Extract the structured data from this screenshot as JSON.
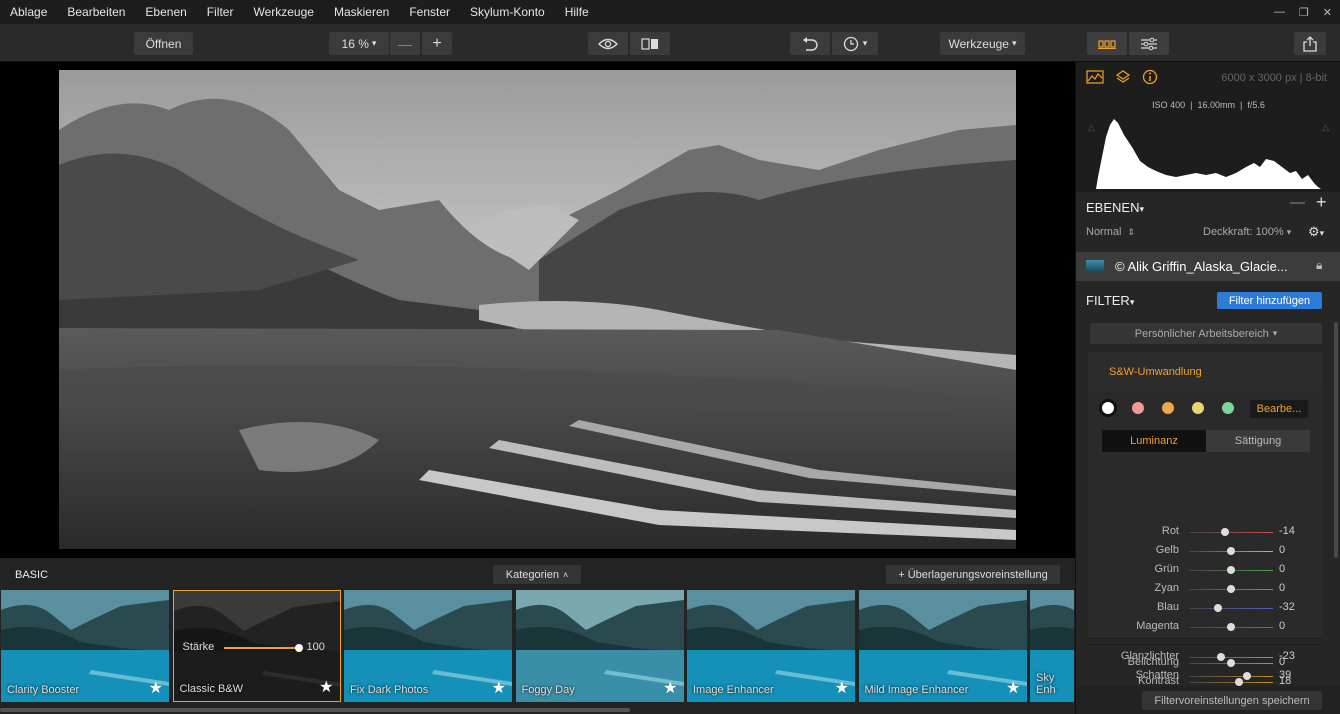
{
  "menu": [
    "Ablage",
    "Bearbeiten",
    "Ebenen",
    "Filter",
    "Werkzeuge",
    "Maskieren",
    "Fenster",
    "Skylum-Konto",
    "Hilfe"
  ],
  "toolbar": {
    "open_label": "Öffnen",
    "zoom_label": "16 %",
    "tools_label": "Werkzeuge"
  },
  "info": {
    "dimensions": "6000 x 3000 px",
    "bitdepth": "8-bit",
    "exif": "ISO 400  |  16.00mm  |  f/5.6"
  },
  "layers": {
    "title": "EBENEN",
    "blend_mode": "Normal",
    "opacity_label": "Deckkraft: 100%",
    "layer_name": "© Alik Griffin_Alaska_Glacie..."
  },
  "filter": {
    "title": "FILTER",
    "add_button": "Filter hinzufügen",
    "workspace": "Persönlicher Arbeitsbereich",
    "module_title": "S&W-Umwandlung",
    "edit_button": "Bearbe...",
    "tabs": [
      "Luminanz",
      "Sättigung"
    ],
    "save_button": "Filtervoreinstellungen speichern",
    "color_dots": [
      "#ffffff",
      "#f29a9a",
      "#f0a848",
      "#ead572",
      "#7fd49a"
    ],
    "luminance_sliders": [
      {
        "label": "Rot",
        "value": "-14",
        "color": "#c85050",
        "level": 0.43
      },
      {
        "label": "Gelb",
        "value": "0",
        "color": "#c8b850",
        "level": 0.5
      },
      {
        "label": "Grün",
        "value": "0",
        "color": "#50a050",
        "level": 0.5
      },
      {
        "label": "Zyan",
        "value": "0",
        "color": "#50a0a8",
        "level": 0.5
      },
      {
        "label": "Blau",
        "value": "-32",
        "color": "#5060c0",
        "level": 0.34
      },
      {
        "label": "Magenta",
        "value": "0",
        "color": "#a050a0",
        "level": 0.5
      }
    ],
    "exposure_sliders": [
      {
        "label": "Belichtung",
        "value": "0",
        "color": "#c0902a",
        "level": 0.5
      },
      {
        "label": "Kontrast",
        "value": "18",
        "color": "#c0902a",
        "level": 0.59
      }
    ],
    "tone_sliders": [
      {
        "label": "Glanzlichter",
        "value": "-23",
        "color": "#c0902a",
        "level": 0.385
      },
      {
        "label": "Schatten",
        "value": "39",
        "color": "#c0902a",
        "level": 0.695
      }
    ]
  },
  "presets": {
    "category": "BASIC",
    "categories_button": "Kategorien",
    "overlay_button": "+ Überlagerungsvoreinstellung",
    "strength_label": "Stärke",
    "strength_value": "100",
    "strength_level": 1.0,
    "items": [
      "Clarity Booster",
      "Classic B&W",
      "Fix Dark Photos",
      "Foggy Day",
      "Image Enhancer",
      "Mild Image Enhancer",
      "Sky Enh"
    ]
  },
  "colors": {
    "accent": "#f0a030",
    "blue_button": "#2d7bd8"
  }
}
